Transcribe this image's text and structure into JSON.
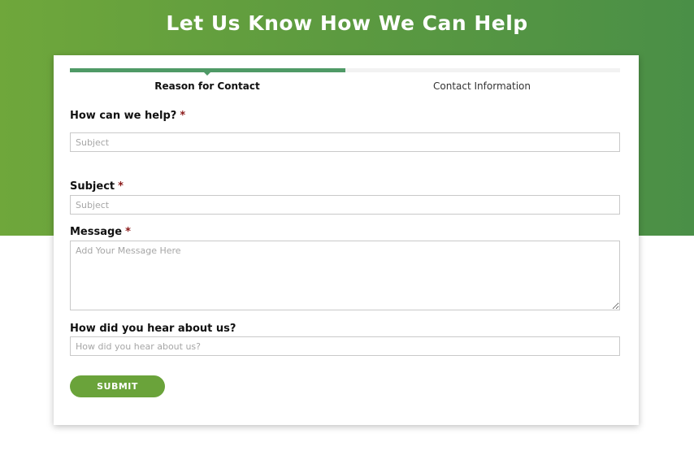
{
  "hero": {
    "title": "Let Us Know How We Can Help"
  },
  "progress": {
    "fraction": 0.5
  },
  "steps": [
    {
      "label": "Reason for Contact",
      "active": true
    },
    {
      "label": "Contact Information",
      "active": false
    }
  ],
  "form": {
    "help": {
      "label": "How can we help?",
      "required": "*",
      "placeholder": "Subject",
      "value": ""
    },
    "subject": {
      "label": "Subject",
      "required": "*",
      "placeholder": "Subject",
      "value": ""
    },
    "message": {
      "label": "Message",
      "required": "*",
      "placeholder": "Add Your Message Here",
      "value": ""
    },
    "referral": {
      "label": "How did you hear about us?",
      "placeholder": "How did you hear about us?",
      "value": ""
    },
    "submit_label": "SUBMIT"
  },
  "colors": {
    "hero_start": "#6fa73b",
    "hero_end": "#4a8f47",
    "progress": "#4f9a66",
    "button": "#6aa33a",
    "required": "#8b1a1a"
  }
}
